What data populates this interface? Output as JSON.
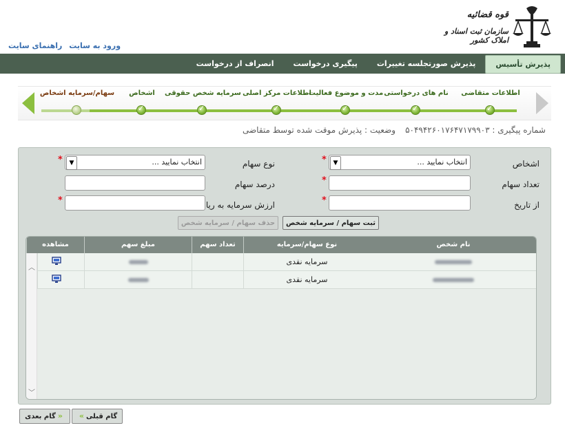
{
  "header": {
    "links": [
      "راهنمای سایت",
      "ورود به سایت"
    ],
    "org_line1": "قوه قضائیه",
    "org_line2": "سازمان ثبت اسناد و املاک کشور"
  },
  "nav": {
    "items": [
      "پذیرش تأسیس",
      "پذیرش صورتجلسه تغییرات",
      "پیگیری درخواست",
      "انصراف از درخواست"
    ]
  },
  "wizard": {
    "steps": [
      "اطلاعات متقاضی",
      "نام های درخواستی",
      "مدت و موضوع فعالیت",
      "اطلاعات مرکز اصلی",
      "سرمایه شخص حقوقی",
      "اشخاص",
      "سهام/سرمایه اشخاص"
    ],
    "current_index": 6
  },
  "status": {
    "tracking_label": "شماره پیگیری : ۵۰۴۹۴۲۶۰۱۷۶۴۷۱۷۹۹۰۳",
    "state_label": "وضعیت : پذیرش موقت شده توسط متقاضی"
  },
  "form": {
    "person_label": "اشخاص",
    "person_select": "انتخاب نمایید ...",
    "share_type_label": "نوع سهام",
    "share_type_select": "انتخاب نمایید ...",
    "share_count_label": "تعداد سهام",
    "share_percent_label": "درصد سهام",
    "from_date_label": "از تاریخ",
    "capital_value_label": "ارزش سرمایه به ریال",
    "register_button": "ثبت سهام / سرمایه شخص",
    "delete_button": "حذف سهام / سرمایه شخص"
  },
  "grid": {
    "headers": [
      "نام شخص",
      "نوع سهام/سرمایه",
      "تعداد سهم",
      "مبلغ سهم",
      "مشاهده"
    ],
    "rows": [
      {
        "type": "سرمایه نقدی"
      },
      {
        "type": "سرمایه نقدی"
      }
    ]
  },
  "footer": {
    "prev_button": "گام قبلی",
    "next_button": "گام بعدی"
  },
  "colors": {
    "nav_bg": "#4b6050",
    "accent_green": "#8cbf3f",
    "required": "#e0121f"
  }
}
